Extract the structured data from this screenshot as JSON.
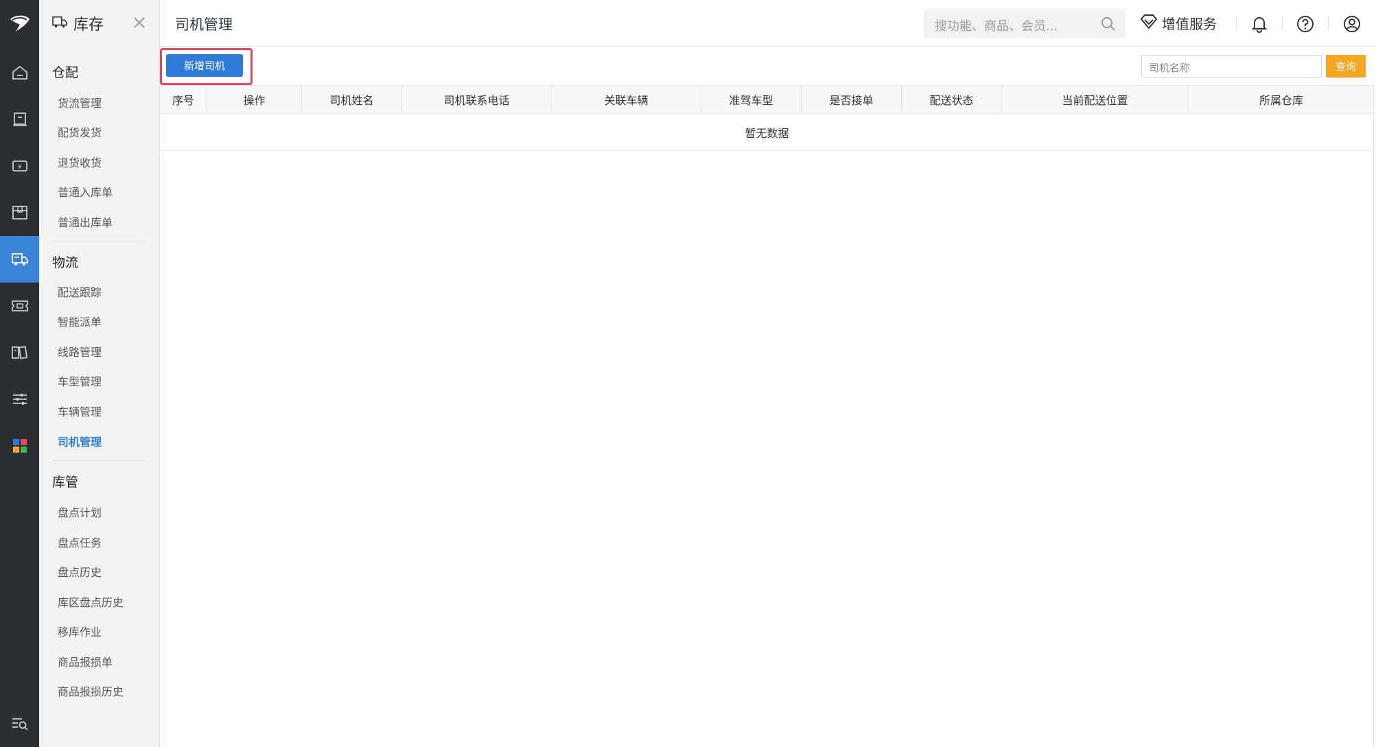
{
  "menu": {
    "title": "库存",
    "groups": [
      {
        "title": "仓配",
        "items": [
          "货流管理",
          "配货发货",
          "退货收货",
          "普通入库单",
          "普通出库单"
        ]
      },
      {
        "title": "物流",
        "items": [
          "配送跟踪",
          "智能派单",
          "线路管理",
          "车型管理",
          "车辆管理",
          "司机管理"
        ]
      },
      {
        "title": "库管",
        "items": [
          "盘点计划",
          "盘点任务",
          "盘点历史",
          "库区盘点历史",
          "移库作业",
          "商品报损单",
          "商品报损历史"
        ]
      }
    ],
    "selected": "司机管理"
  },
  "rail": {
    "icons": [
      "logo-icon",
      "home-icon",
      "product-icon",
      "finance-icon",
      "package-icon",
      "truck-icon",
      "ticket-icon",
      "report-icon",
      "settings-icon",
      "apps-icon",
      "search-menu-icon"
    ],
    "active": "truck-icon"
  },
  "header": {
    "page_title": "司机管理",
    "search_placeholder": "搜功能、商品、会员...",
    "value_added_label": "增值服务"
  },
  "toolbar": {
    "add_driver_label": "新增司机",
    "driver_name_placeholder": "司机名称",
    "query_label": "查询"
  },
  "table": {
    "columns": [
      "序号",
      "操作",
      "司机姓名",
      "司机联系电话",
      "关联车辆",
      "准驾车型",
      "是否接单",
      "配送状态",
      "当前配送位置",
      "所属仓库"
    ],
    "empty_text": "暂无数据"
  },
  "colors": {
    "primary": "#2f7bd9",
    "query_button": "#f5a623",
    "highlight_frame": "#e8485e",
    "rail_bg": "#2b2f33"
  }
}
